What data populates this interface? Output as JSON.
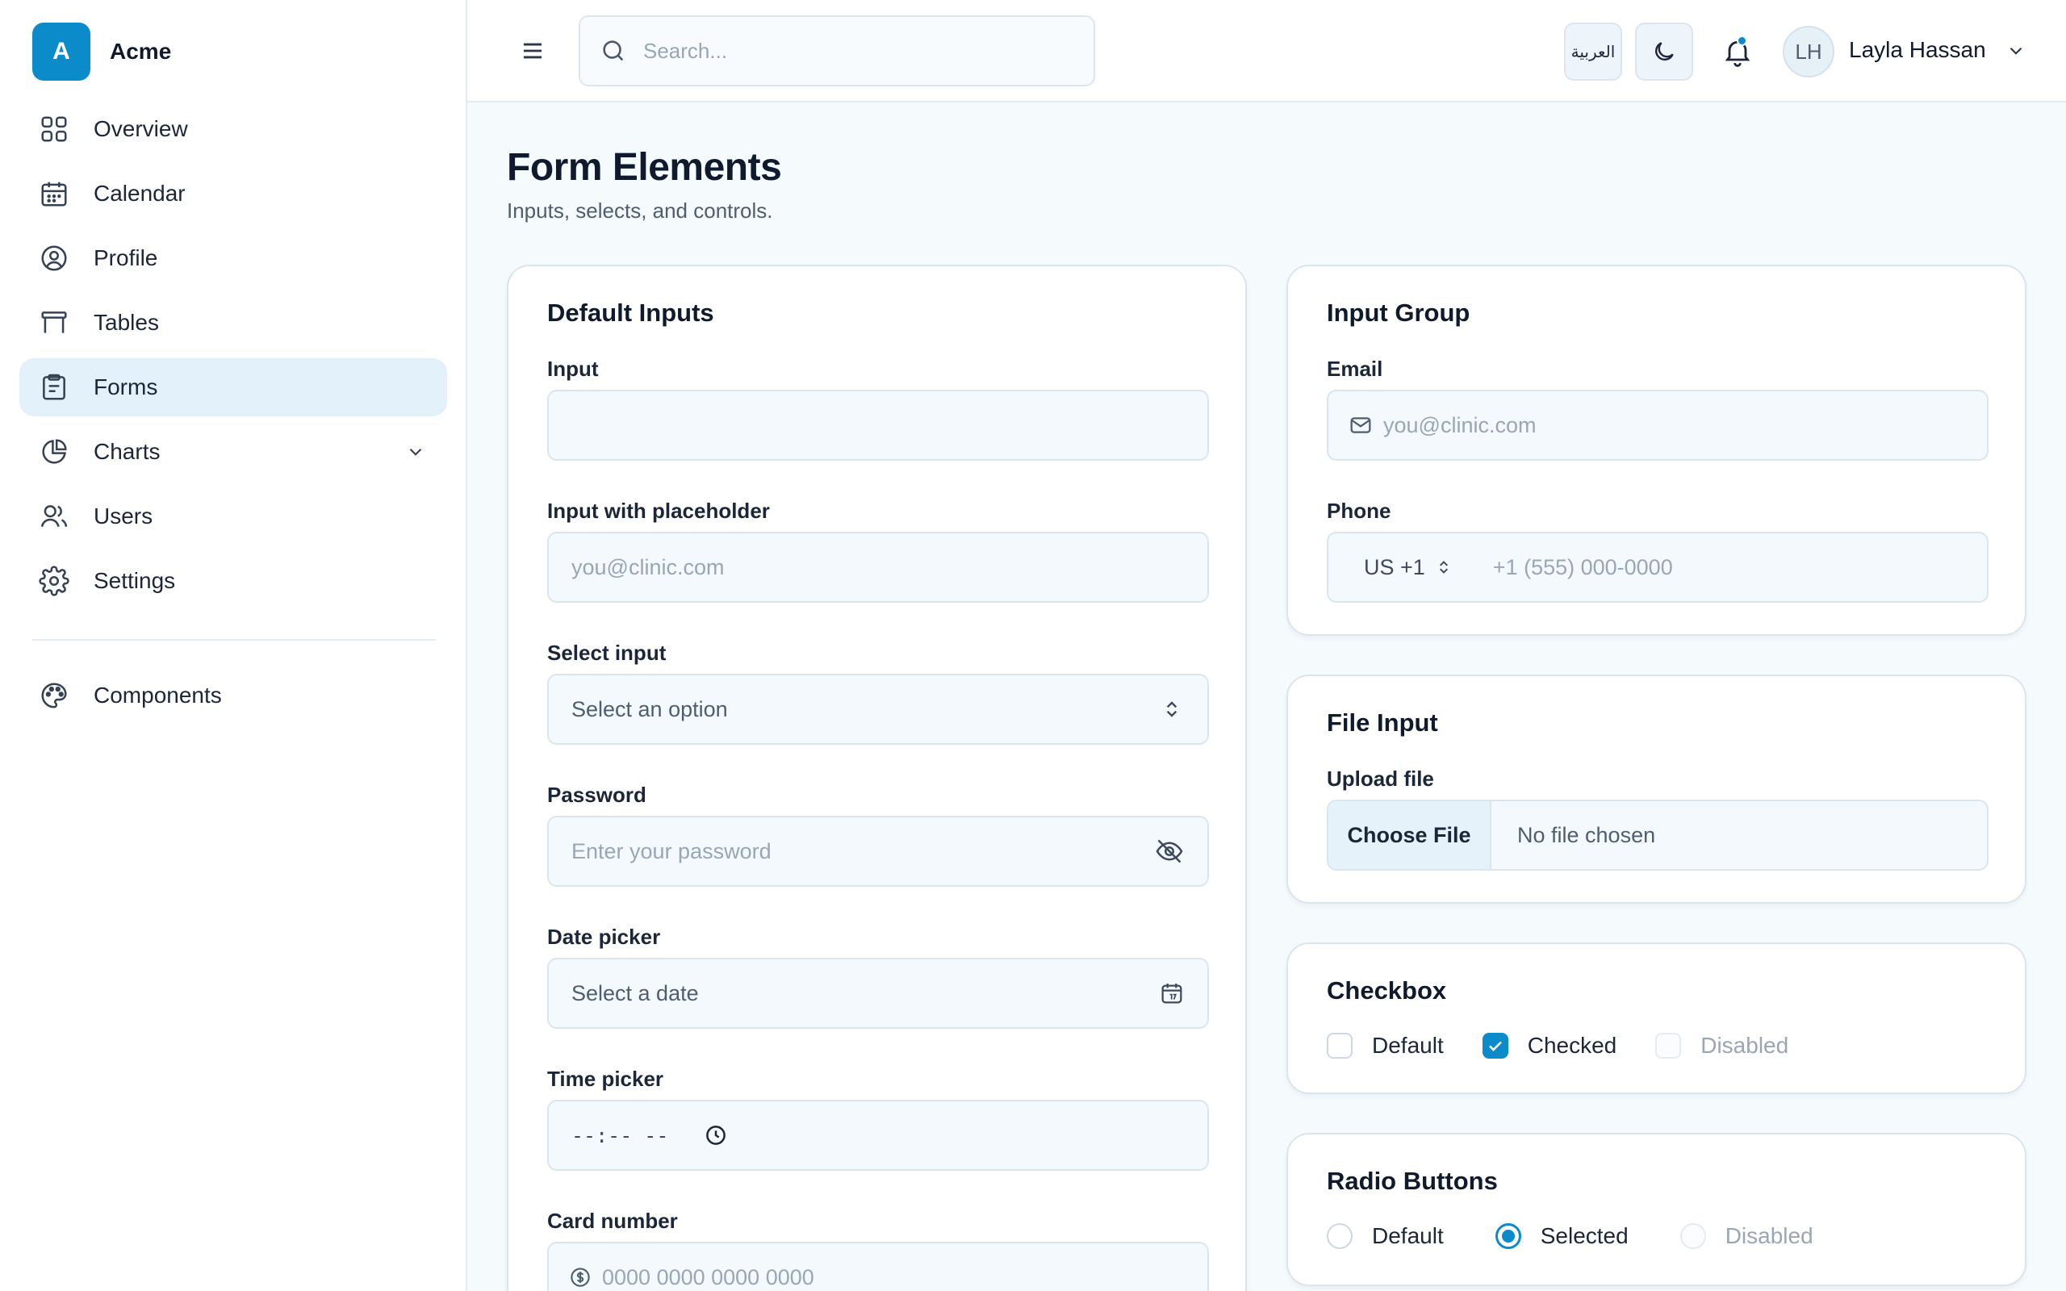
{
  "brand": {
    "logo_letter": "A",
    "name": "Acme"
  },
  "sidebar": {
    "items": [
      {
        "label": "Overview",
        "icon": "grid-icon"
      },
      {
        "label": "Calendar",
        "icon": "calendar-icon"
      },
      {
        "label": "Profile",
        "icon": "user-circle-icon"
      },
      {
        "label": "Tables",
        "icon": "table-icon"
      },
      {
        "label": "Forms",
        "icon": "clipboard-icon",
        "active": true
      },
      {
        "label": "Charts",
        "icon": "pie-chart-icon",
        "expandable": true
      },
      {
        "label": "Users",
        "icon": "users-icon"
      },
      {
        "label": "Settings",
        "icon": "gear-icon"
      }
    ],
    "secondary": [
      {
        "label": "Components",
        "icon": "palette-icon"
      }
    ]
  },
  "header": {
    "search_placeholder": "Search...",
    "language_label": "العربية",
    "user": {
      "initials": "LH",
      "name": "Layla Hassan"
    }
  },
  "page": {
    "title": "Form Elements",
    "subtitle": "Inputs, selects, and controls."
  },
  "default_inputs": {
    "title": "Default Inputs",
    "input": {
      "label": "Input",
      "value": ""
    },
    "input_placeholder": {
      "label": "Input with placeholder",
      "placeholder": "you@clinic.com"
    },
    "select": {
      "label": "Select input",
      "value": "Select an option"
    },
    "password": {
      "label": "Password",
      "placeholder": "Enter your password"
    },
    "date": {
      "label": "Date picker",
      "placeholder": "Select a date"
    },
    "time": {
      "label": "Time picker",
      "value": "--:-- --"
    },
    "card": {
      "label": "Card number",
      "placeholder": "0000 0000 0000 0000"
    }
  },
  "input_group": {
    "title": "Input Group",
    "email": {
      "label": "Email",
      "placeholder": "you@clinic.com"
    },
    "phone": {
      "label": "Phone",
      "country": "US +1",
      "placeholder": "+1 (555) 000-0000"
    }
  },
  "file_input": {
    "title": "File Input",
    "label": "Upload file",
    "button": "Choose File",
    "status": "No file chosen"
  },
  "checkbox": {
    "title": "Checkbox",
    "options": [
      {
        "label": "Default",
        "state": "unchecked"
      },
      {
        "label": "Checked",
        "state": "checked"
      },
      {
        "label": "Disabled",
        "state": "disabled"
      }
    ]
  },
  "radio": {
    "title": "Radio Buttons",
    "options": [
      {
        "label": "Default",
        "state": "unselected"
      },
      {
        "label": "Selected",
        "state": "selected"
      },
      {
        "label": "Disabled",
        "state": "disabled"
      }
    ]
  },
  "colors": {
    "accent": "#0b8bc9",
    "active_nav_bg": "#e3f1fa",
    "page_bg": "#f5fafd"
  }
}
